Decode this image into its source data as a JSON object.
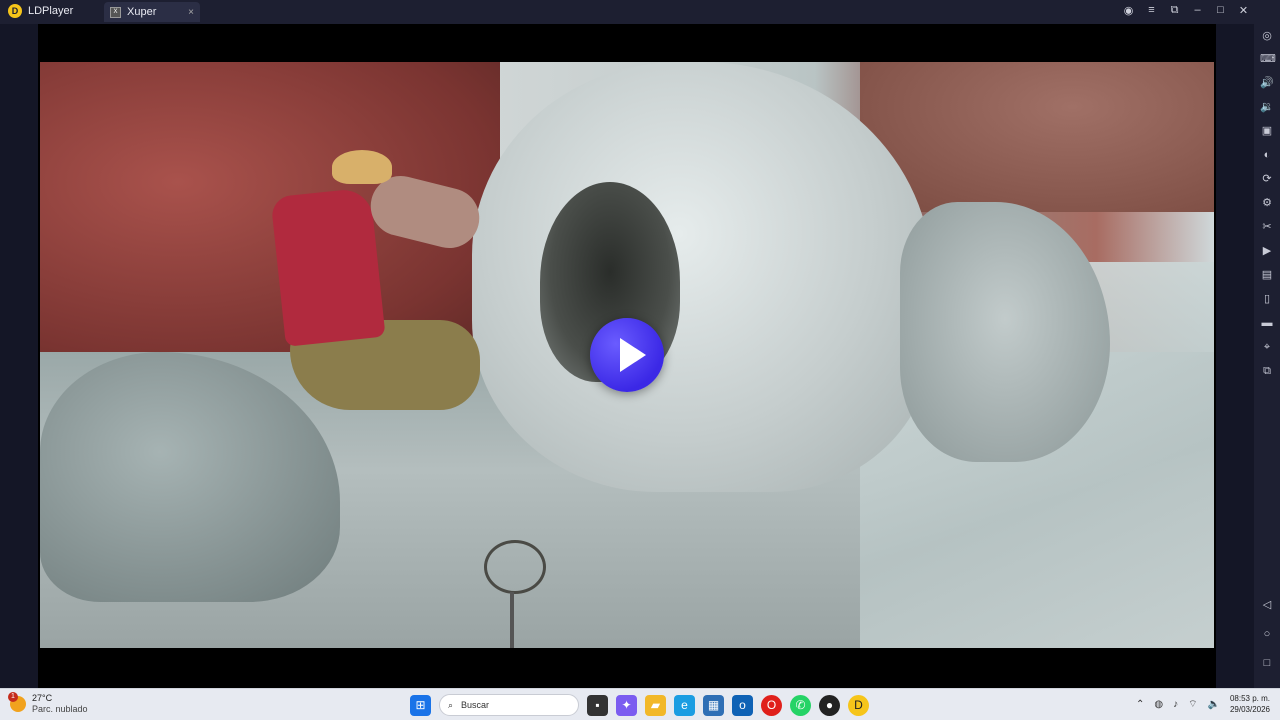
{
  "titlebar": {
    "app_name": "LDPlayer",
    "tab_label": "Xuper",
    "tab_close": "×"
  },
  "video": {
    "state": "paused",
    "play_button_label": "Play"
  },
  "sidebar": {
    "icons": [
      "gamepad-icon",
      "keyboard-icon",
      "volume-up-icon",
      "volume-down-icon",
      "screenshot-icon",
      "record-icon",
      "sync-icon",
      "robot-icon",
      "scissors-icon",
      "video-icon",
      "apk-icon",
      "phone-shake-icon",
      "folder-icon",
      "location-icon",
      "multi-instance-icon",
      "back-icon",
      "home-icon",
      "recents-icon"
    ]
  },
  "taskbar": {
    "weather_temp": "27°C",
    "weather_condition": "Parc. nublado",
    "weather_badge": "1",
    "search_placeholder": "Buscar",
    "time": "08:53 p. m.",
    "date": "29/03/2026",
    "apps": [
      "start-icon",
      "search-box",
      "file-explorer-icon",
      "copilot-icon",
      "folder-icon",
      "edge-icon",
      "store-icon",
      "outlook-icon",
      "opera-icon",
      "whatsapp-icon",
      "app-red-icon",
      "ldplayer-icon"
    ]
  },
  "colors": {
    "titlebar_bg": "#1d1f31",
    "play_button": "#3b28e6",
    "taskbar_bg": "#e7eaf1"
  }
}
